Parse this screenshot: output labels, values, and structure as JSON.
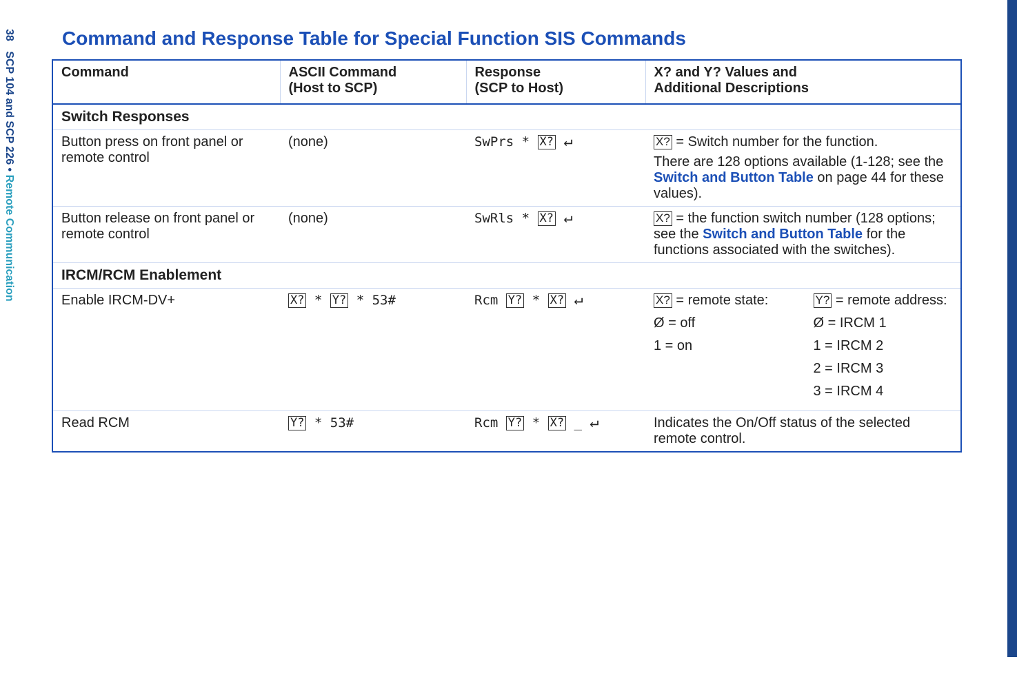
{
  "page": {
    "number": "38",
    "docref": "SCP 104 and SCP 226",
    "section": "Remote Communication"
  },
  "title": "Command and Response Table for Special Function SIS Commands",
  "headers": {
    "command": "Command",
    "ascii_l1": "ASCII Command",
    "ascii_l2": "(Host to SCP)",
    "resp_l1": "Response",
    "resp_l2": "(SCP to Host)",
    "desc_l1": "X? and Y? Values and",
    "desc_l2": "Additional Descriptions"
  },
  "sections": {
    "switch_responses": "Switch Responses",
    "ircm_rcm": "IRCM/RCM Enablement"
  },
  "tokens": {
    "X": "X?",
    "Y": "Y?",
    "ret": "↵",
    "zero": "Ø"
  },
  "rows": {
    "r1": {
      "command": "Button press on front panel or remote control",
      "ascii": "(none)",
      "resp_a": "SwPrs * ",
      "desc_a": " = Switch number for the function.",
      "desc_b1": "There are 128 options available (1-128; see the ",
      "desc_b_link": "Switch and Button Table",
      "desc_b2": " on page 44 for these values)."
    },
    "r2": {
      "command": "Button release on front panel or remote control",
      "ascii": "(none)",
      "resp_a": "SwRls * ",
      "desc_a": " = the function switch number (128 options; see the ",
      "desc_link": "Switch and Button Table",
      "desc_b": " for the functions associated with the switches)."
    },
    "r3": {
      "command": "Enable IRCM-DV+",
      "ascii_suffix": " * 53#",
      "resp_a": "Rcm ",
      "left_hdr": " = remote state:",
      "left_v0": " = off",
      "left_v1": "1 = on",
      "right_hdr": " = remote address:",
      "right_v0": " = IRCM 1",
      "right_v1": "1 = IRCM 2",
      "right_v2": "2 = IRCM 3",
      "right_v3": "3 = IRCM 4"
    },
    "r4": {
      "command": "Read RCM",
      "ascii_suffix": " * 53#",
      "resp_a": "Rcm ",
      "resp_sep": " _ ",
      "desc": "Indicates the On/Off status of the selected remote control."
    }
  }
}
